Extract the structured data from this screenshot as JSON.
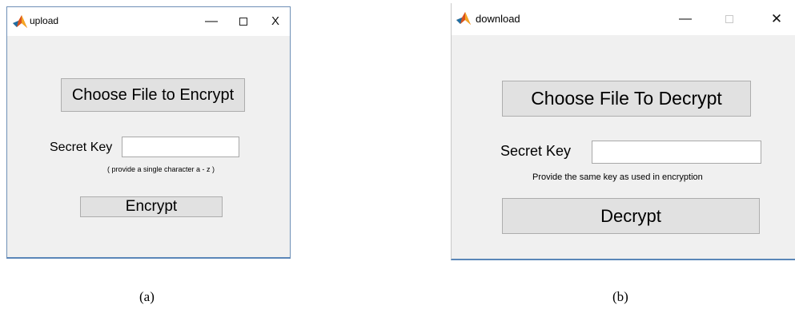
{
  "upload_window": {
    "title": "upload",
    "icon": "matlab-icon",
    "controls": {
      "minimize": "—",
      "maximize": "",
      "close": "X"
    },
    "choose_button": "Choose File to Encrypt",
    "key_label": "Secret Key",
    "key_value": "",
    "hint": "( provide a single character a - z )",
    "action_button": "Encrypt"
  },
  "download_window": {
    "title": "download",
    "icon": "matlab-icon",
    "controls": {
      "minimize": "—",
      "maximize": "",
      "close": "✕"
    },
    "choose_button": "Choose File To Decrypt",
    "key_label": "Secret Key",
    "key_value": "",
    "hint": "Provide the same key as used in encryption",
    "action_button": "Decrypt"
  },
  "captions": {
    "a": "(a)",
    "b": "(b)"
  }
}
